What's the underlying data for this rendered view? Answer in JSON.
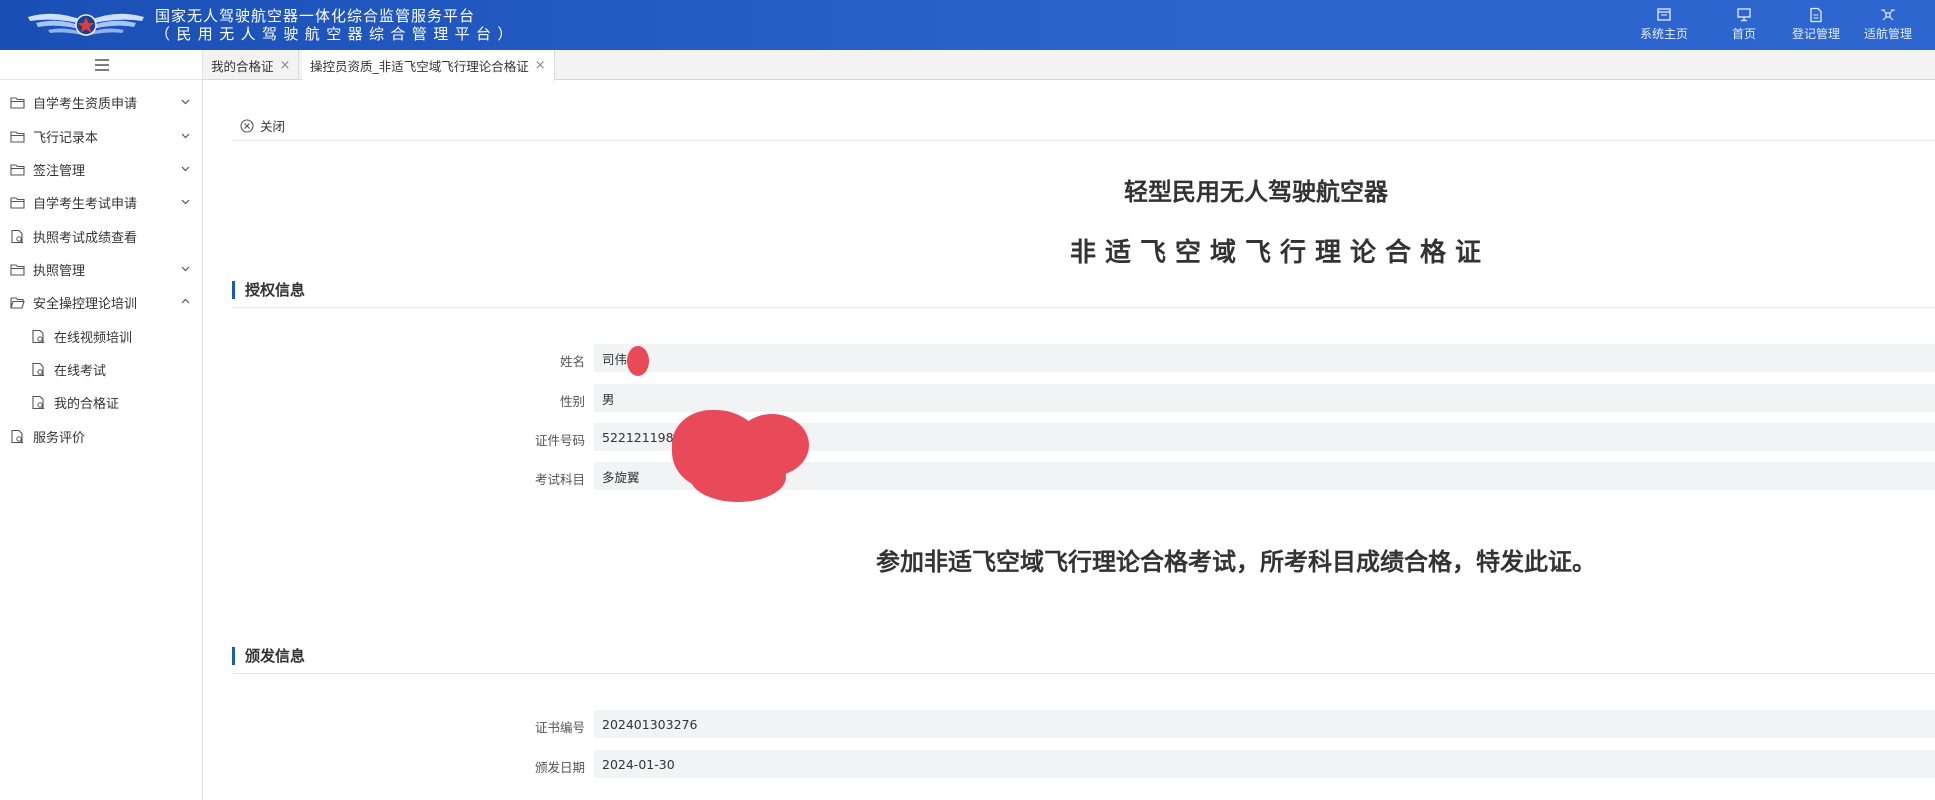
{
  "header": {
    "title_line1": "国家无人驾驶航空器一体化综合监管服务平台",
    "title_line2": "（民用无人驾驶航空器综合管理平台）",
    "nav": [
      {
        "label": "系统主页",
        "icon": "system-home-icon"
      },
      {
        "label": "首页",
        "icon": "monitor-icon"
      },
      {
        "label": "登记管理",
        "icon": "document-edit-icon"
      },
      {
        "label": "适航管理",
        "icon": "drone-icon"
      }
    ]
  },
  "sidebar": {
    "items": [
      {
        "label": "自学考生资质申请",
        "icon": "folder-icon",
        "expandable": true
      },
      {
        "label": "飞行记录本",
        "icon": "folder-icon",
        "expandable": true
      },
      {
        "label": "签注管理",
        "icon": "folder-icon",
        "expandable": true
      },
      {
        "label": "自学考生考试申请",
        "icon": "folder-icon",
        "expandable": true
      },
      {
        "label": "执照考试成绩查看",
        "icon": "file-search-icon",
        "expandable": false
      },
      {
        "label": "执照管理",
        "icon": "folder-icon",
        "expandable": true
      },
      {
        "label": "安全操控理论培训",
        "icon": "folder-open-icon",
        "expandable": true,
        "expanded": true
      },
      {
        "label": "在线视频培训",
        "icon": "file-search-icon",
        "sub": true
      },
      {
        "label": "在线考试",
        "icon": "file-search-icon",
        "sub": true
      },
      {
        "label": "我的合格证",
        "icon": "file-search-icon",
        "sub": true
      },
      {
        "label": "服务评价",
        "icon": "file-search-icon",
        "expandable": false
      }
    ]
  },
  "tabs": [
    {
      "label": "我的合格证",
      "active": false
    },
    {
      "label": "操控员资质_非适飞空域飞行理论合格证",
      "active": true
    }
  ],
  "main": {
    "close_label": "关闭",
    "title1": "轻型民用无人驾驶航空器",
    "title2": "非适飞空域飞行理论合格证",
    "auth_section": "授权信息",
    "fields": {
      "name_label": "姓名",
      "name_value": "司伟",
      "gender_label": "性别",
      "gender_value": "男",
      "id_label": "证件号码",
      "id_value": "522121198",
      "subject_label": "考试科目",
      "subject_value": "多旋翼"
    },
    "statement": "参加非适飞空域飞行理论合格考试，所考科目成绩合格，特发此证。",
    "issue_section": "颁发信息",
    "issue": {
      "cert_no_label": "证书编号",
      "cert_no_value": "202401303276",
      "date_label": "颁发日期",
      "date_value": "2024-01-30"
    }
  },
  "colors": {
    "header_blue": "#2a63cc",
    "section_bar": "#1e5ab4",
    "redaction": "#e94a5a"
  }
}
